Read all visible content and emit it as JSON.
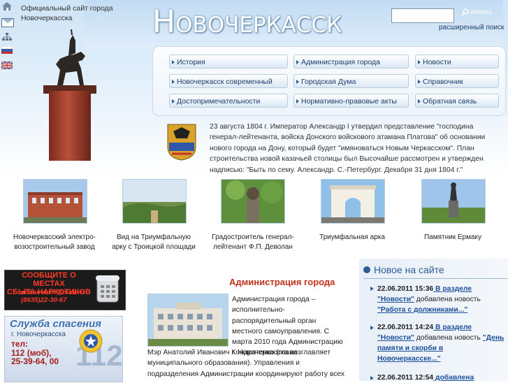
{
  "header": {
    "official_line1": "Официальный сайт города",
    "official_line2": "Новочеркасска",
    "logo": "Новочеркасск",
    "search_placeholder": "",
    "search_button": "искать",
    "advanced_search": "расширенный поиск"
  },
  "icons": [
    "home-icon",
    "mail-icon",
    "sitemap-icon",
    "flag-ru-icon",
    "flag-uk-icon",
    "search-icon"
  ],
  "nav": {
    "col1": [
      "История",
      "Новочеркасск современный",
      "Достопримечательности"
    ],
    "col2": [
      "Администрация города",
      "Городская Дума",
      "Нормативно-правовые акты"
    ],
    "col3": [
      "Новости",
      "Справочник",
      "Обратная связь"
    ]
  },
  "intro": "23 августа 1804 г. Император Александр I утвердил представление \"господина генерал-лейтенанта, войска Донского войскового атамана Платова\" об основании нового города на Дону, который будет \"имяноваться Новым Черкасском\". План строительства новой казачьей столицы был Высочайше рассмотрен и утвержден надписью: \"Быть по сему. Александр. С.-Петербург. Декабря 31 дня 1804 г.\"",
  "photos": [
    {
      "line1": "Новочеркасский электро-",
      "line2": "возостроительный завод"
    },
    {
      "line1": "Вид на Триумфальную",
      "line2": "арку с Троицкой площади"
    },
    {
      "line1": "Градостроитель генерал-",
      "line2": "лейтенант Ф.П. Деволан"
    },
    {
      "line1": "Триумфальная арка",
      "line2": ""
    },
    {
      "line1": "Памятник Ермаку",
      "line2": ""
    }
  ],
  "drug_banner": {
    "line1": "СООБЩИТЕ О МЕСТАХ",
    "line2": "СБЫТА НАРКОТИКОВ",
    "email": "anknovoch@mail.ru",
    "phone": "(8635)22-30-67"
  },
  "rescue": {
    "title": "Служба спасения",
    "city": "г. Новочеркасска",
    "tel_label": "тел:",
    "phone1": "112 (моб),",
    "phone2": "25-39-64, 00",
    "big": "112"
  },
  "admin": {
    "title": "Администрация города",
    "text1": "Администрация города – исполнительно-распорядительный орган местного самоуправления. С марта 2010 года Администрацию г. Новочеркасска возглавляет",
    "text2": "Мэр Анатолий Иванович Кондратенко (глава муниципального образования). Управления и подразделения Администрации координируют работу всех"
  },
  "news": {
    "title": "Новое на сайте",
    "items": [
      {
        "date": "22.06.2011 15:36",
        "pre": " В разделе ",
        "section": "\"Новости\"",
        "mid": " добавлена новость ",
        "headline": "\"Работа с должниками...\""
      },
      {
        "date": "22.06.2011 14:24",
        "pre": " В разделе ",
        "section": "\"Новости\"",
        "mid": " добавлена новость ",
        "headline": "\"День памяти и скорби в Новочеркасске...\""
      },
      {
        "date": "22.06.2011 12:54",
        "pre": " добавлена",
        "section": "",
        "mid": "",
        "headline": ""
      }
    ]
  },
  "colors": {
    "accent": "#1d4f9a",
    "admin_title": "#c0331c",
    "drug_text": "#ff3b2a"
  }
}
